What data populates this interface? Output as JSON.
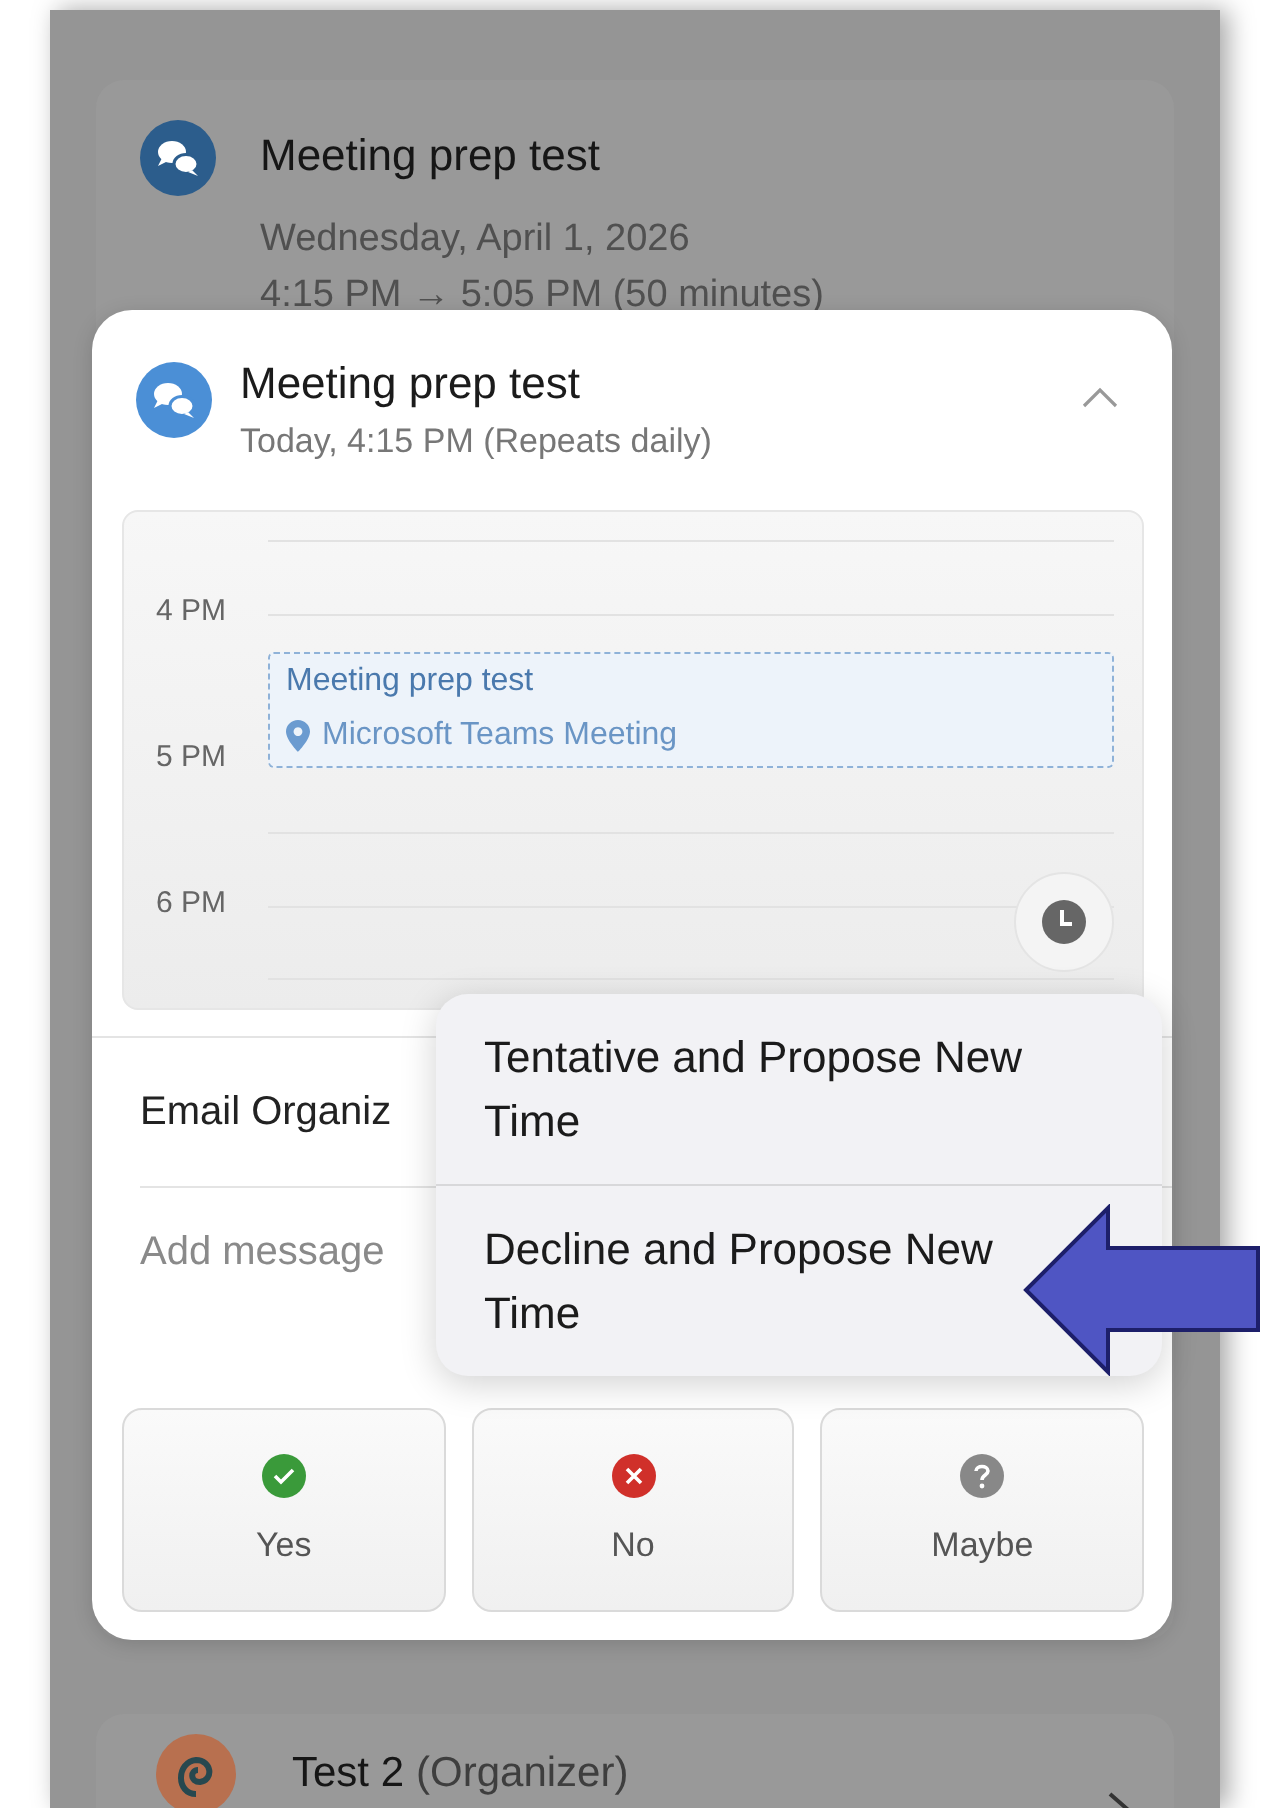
{
  "background_event": {
    "title": "Meeting prep test",
    "date": "Wednesday, April 1, 2026",
    "time": "4:15 PM → 5:05 PM (50 minutes)"
  },
  "event_card": {
    "title": "Meeting prep test",
    "subtitle": "Today, 4:15 PM (Repeats daily)",
    "expanded": true,
    "timeline": {
      "hours": [
        "4 PM",
        "5 PM",
        "6 PM"
      ],
      "event": {
        "title": "Meeting prep test",
        "location": "Microsoft Teams Meeting"
      }
    },
    "email_organizer": "Email Organiz",
    "message": {
      "placeholder": "Add message"
    },
    "responses": [
      {
        "kind": "yes",
        "label": "Yes"
      },
      {
        "kind": "no",
        "label": "No"
      },
      {
        "kind": "maybe",
        "label": "Maybe"
      }
    ]
  },
  "menu": [
    {
      "label": "Tentative and Propose New Time"
    },
    {
      "label": "Decline and Propose New Time"
    }
  ],
  "next_event": {
    "title": "Test 2",
    "role": "(Organizer)"
  }
}
